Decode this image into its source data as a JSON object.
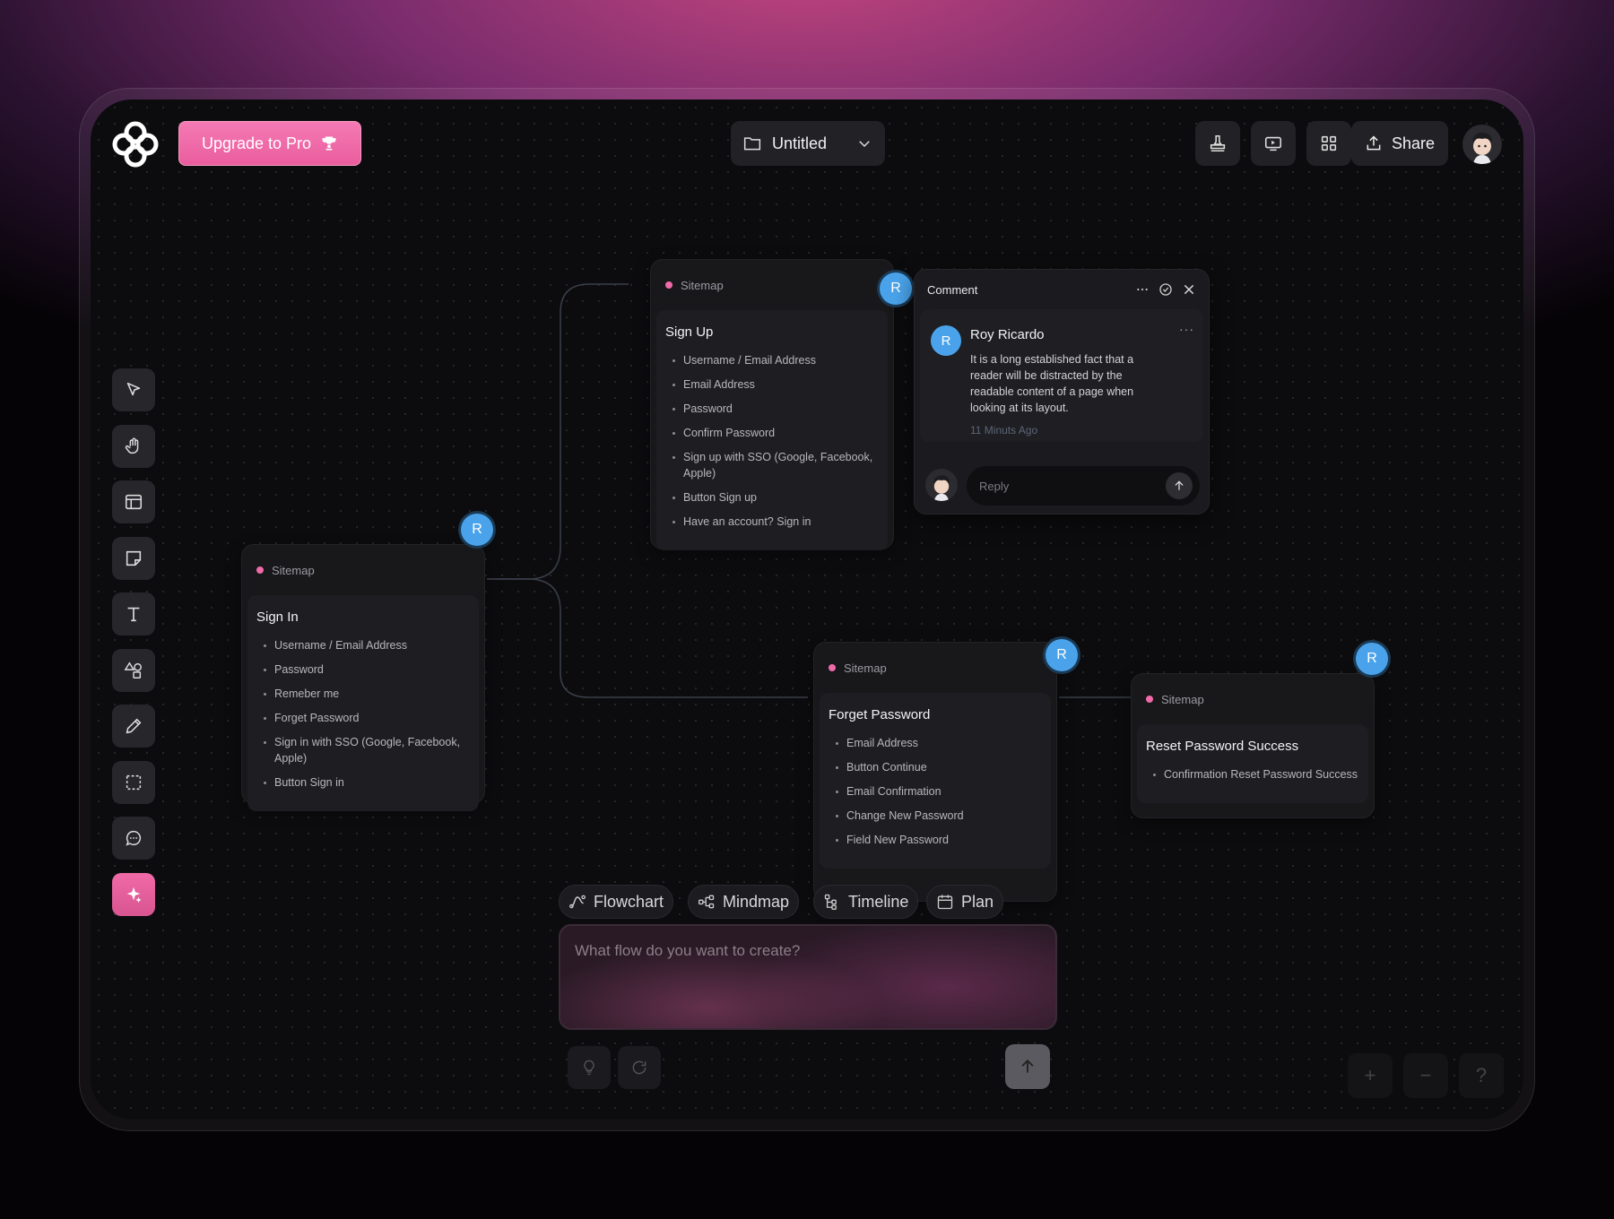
{
  "header": {
    "upgrade_label": "Upgrade to Pro",
    "file_name": "Untitled",
    "share_label": "Share"
  },
  "toolbar": {
    "tools": [
      "select",
      "hand",
      "layout",
      "sticky-note",
      "text",
      "shapes",
      "pen",
      "frame",
      "comment",
      "ai"
    ]
  },
  "cards": {
    "signup": {
      "tag": "Sitemap",
      "title": "Sign Up",
      "items": [
        "Username / Email Address",
        "Email Address",
        "Password",
        "Confirm Password",
        "Sign up with SSO (Google, Facebook, Apple)",
        "Button Sign up",
        "Have an account? Sign in"
      ],
      "badge": "R"
    },
    "signin": {
      "tag": "Sitemap",
      "title": "Sign In",
      "items": [
        "Username / Email Address",
        "Password",
        "Remeber me",
        "Forget Password",
        "Sign in with SSO (Google, Facebook, Apple)",
        "Button Sign in"
      ],
      "badge": "R"
    },
    "forget": {
      "tag": "Sitemap",
      "title": "Forget Password",
      "items": [
        "Email Address",
        "Button Continue",
        "Email Confirmation",
        "Change New Password",
        "Field New Password"
      ],
      "badge": "R"
    },
    "reset": {
      "tag": "Sitemap",
      "title": "Reset Password Success",
      "items": [
        "Confirmation Reset Password Success"
      ],
      "badge": "R"
    }
  },
  "comment": {
    "header": "Comment",
    "author_initial": "R",
    "author": "Roy Ricardo",
    "text": "It is a long established fact that a reader will be distracted by the readable content of a page when looking at its layout.",
    "time": "11 Minuts Ago",
    "reply_placeholder": "Reply"
  },
  "generator": {
    "chips": [
      "Flowchart",
      "Mindmap",
      "Timeline",
      "Plan"
    ],
    "placeholder": "What flow do you want to create?"
  },
  "zoom": {
    "plus": "+",
    "minus": "−",
    "help": "?"
  },
  "colors": {
    "accent": "#ef6aa8",
    "badge": "#4aa3ea"
  }
}
